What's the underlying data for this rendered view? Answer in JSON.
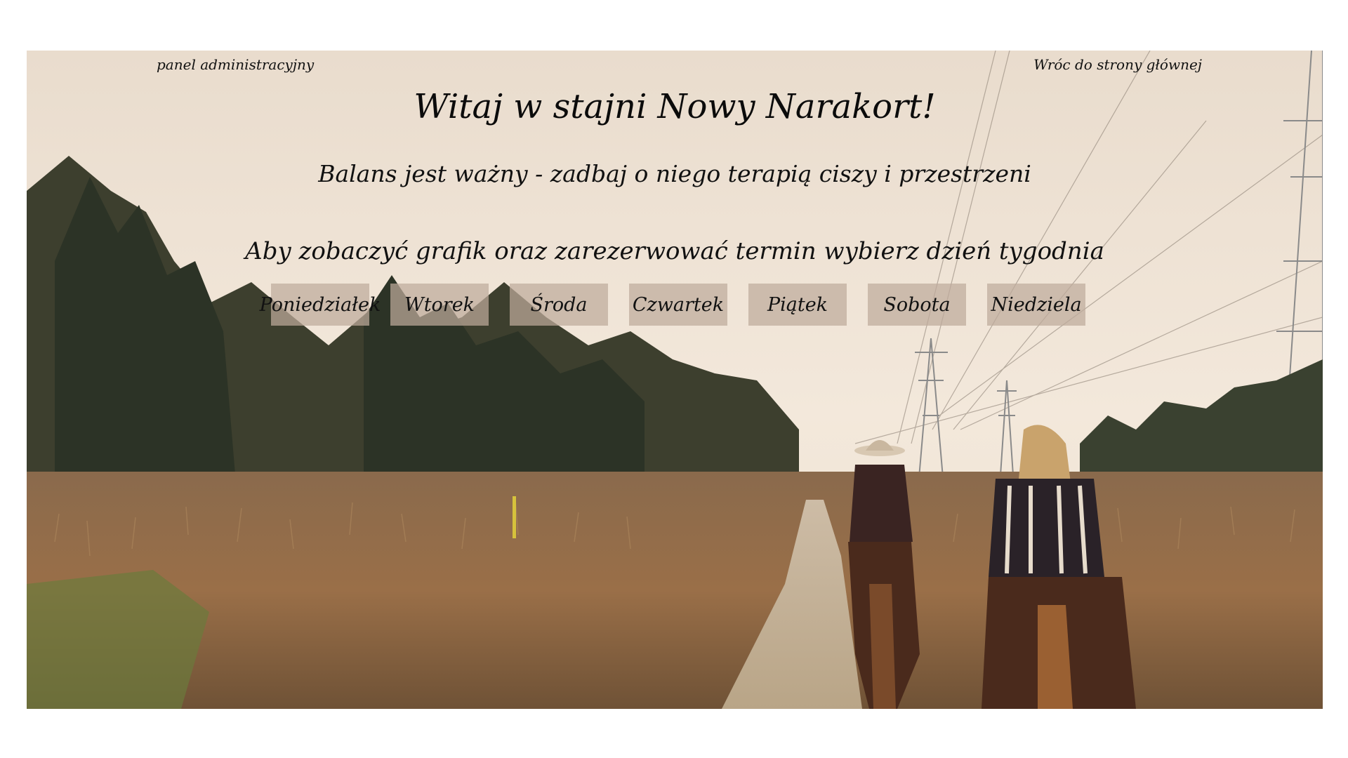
{
  "header": {
    "admin_link": "panel administracyjny",
    "home_link": "Wróc do strony głównej"
  },
  "hero": {
    "title": "Witaj w stajni Nowy Narakort!",
    "subtitle": "Balans jest ważny - zadbaj o niego terapią ciszy i przestrzeni",
    "prompt": "Aby zobaczyć grafik oraz zarezerwować termin wybierz dzień tygodnia"
  },
  "days": [
    "Poniedziałek",
    "Wtorek",
    "Środa",
    "Czwartek",
    "Piątek",
    "Sobota",
    "Niedziela"
  ],
  "colors": {
    "sky": "#efe3d3",
    "button_bg": "#bfaa9b",
    "text": "#111111"
  }
}
